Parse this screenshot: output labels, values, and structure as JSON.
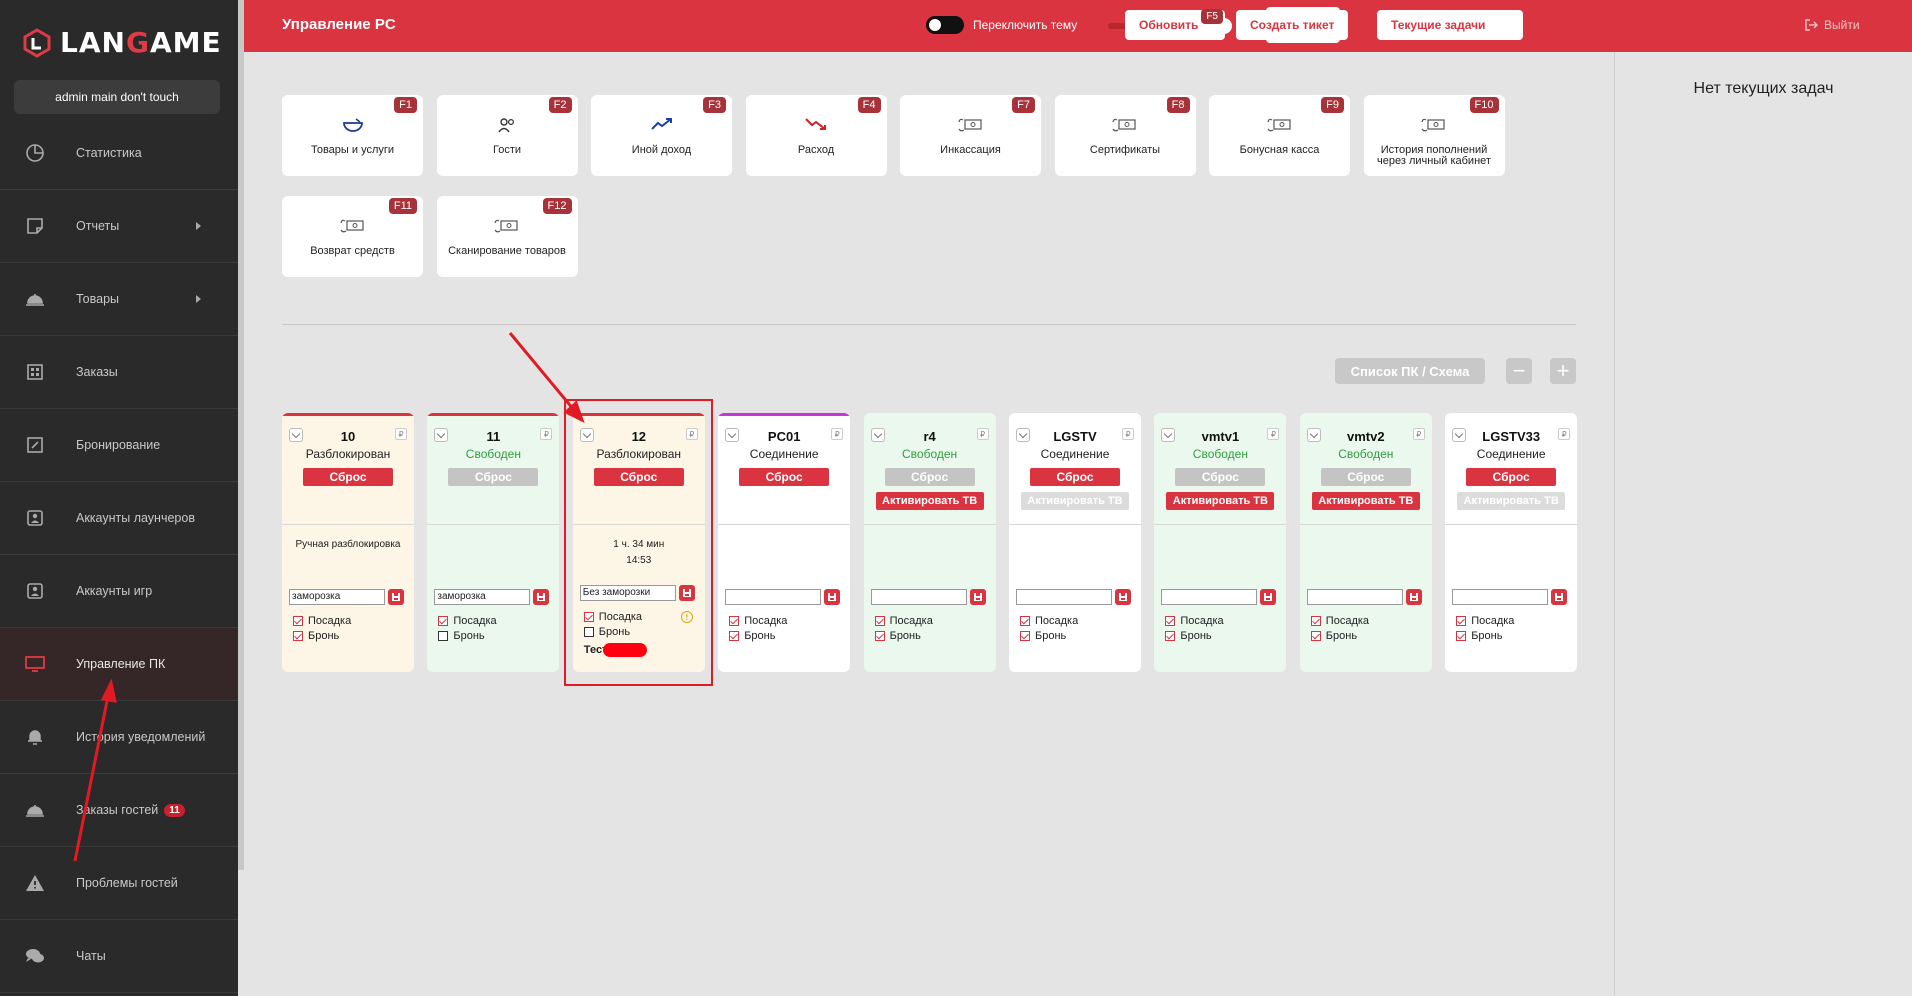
{
  "sidebar": {
    "logo_text": "LANGAME",
    "user": "admin main don't touch",
    "items": [
      {
        "label": "Статистика",
        "icon": "pie-chart-icon",
        "arrow": false
      },
      {
        "label": "Отчеты",
        "icon": "report-icon",
        "arrow": true
      },
      {
        "label": "Товары",
        "icon": "cloche-icon",
        "arrow": true
      },
      {
        "label": "Заказы",
        "icon": "grid-icon",
        "arrow": false
      },
      {
        "label": "Бронирование",
        "icon": "edit-square-icon",
        "arrow": false
      },
      {
        "label": "Аккаунты лаунчеров",
        "icon": "account-card-icon",
        "arrow": false
      },
      {
        "label": "Аккаунты игр",
        "icon": "account-card-icon",
        "arrow": false
      },
      {
        "label": "Управление ПК",
        "icon": "monitor-icon",
        "arrow": false,
        "active": true
      },
      {
        "label": "История уведомлений",
        "icon": "bell-icon",
        "arrow": false
      },
      {
        "label": "Заказы гостей",
        "icon": "cloche-icon",
        "arrow": false,
        "badge": "11"
      },
      {
        "label": "Проблемы гостей",
        "icon": "warning-icon",
        "arrow": false
      },
      {
        "label": "Чаты",
        "icon": "chat-icon",
        "arrow": false
      }
    ]
  },
  "header": {
    "title": "Управление PC",
    "theme_toggle_label": "Переключить тему",
    "language": "ru",
    "refresh_label": "Обновить",
    "refresh_key": "F5",
    "ticket_label": "Создать тикет",
    "tasks_label": "Текущие задачи",
    "logout_label": "Выйти"
  },
  "right_panel": {
    "message": "Нет текущих задач"
  },
  "tiles": [
    {
      "label": "Товары и услуги",
      "key": "F1",
      "icon": "bowl-icon"
    },
    {
      "label": "Гости",
      "key": "F2",
      "icon": "users-icon"
    },
    {
      "label": "Иной доход",
      "key": "F3",
      "icon": "trend-up-icon"
    },
    {
      "label": "Расход",
      "key": "F4",
      "icon": "trend-down-icon"
    },
    {
      "label": "Инкассация",
      "key": "F7",
      "icon": "money-cycle-icon"
    },
    {
      "label": "Сертификаты",
      "key": "F8",
      "icon": "money-cycle-icon"
    },
    {
      "label": "Бонусная касса",
      "key": "F9",
      "icon": "money-cycle-icon"
    },
    {
      "label": "История пополнений через личный кабинет",
      "key": "F10",
      "icon": "money-cycle-icon"
    },
    {
      "label": "Возврат средств",
      "key": "F11",
      "icon": "money-cycle-icon"
    },
    {
      "label": "Сканирование товаров",
      "key": "F12",
      "icon": "money-cycle-icon"
    }
  ],
  "controls": {
    "list_scheme_label": "Список ПК / Схема",
    "zoom_out": "−",
    "zoom_in": "+"
  },
  "colors": {
    "accent": "#d93440",
    "sidebar": "#2a2a2a",
    "free_text": "#2e9e3e",
    "warn_bg": "#fdf6e6",
    "free_bg": "#eaf8ee"
  },
  "pcs": [
    {
      "name": "10",
      "status": "Разблокирован",
      "status_color": "#222",
      "bg": "#fdf6e6",
      "bar": "#d93440",
      "reset_label": "Сброс",
      "reset_active": true,
      "activate": null,
      "note": [
        "Ручная разблокировка"
      ],
      "input_value": "заморозка",
      "posadka_label": "Посадка",
      "posadka": true,
      "bron_label": "Бронь",
      "bron": true
    },
    {
      "name": "11",
      "status": "Свободен",
      "status_color": "#2e9e3e",
      "bg": "#eaf8ee",
      "bar": "#d93440",
      "reset_label": "Сброс",
      "reset_active": false,
      "activate": null,
      "note": [],
      "input_value": "заморозка",
      "posadka_label": "Посадка",
      "posadka": true,
      "bron_label": "Бронь",
      "bron": false
    },
    {
      "name": "12",
      "status": "Разблокирован",
      "status_color": "#222",
      "bg": "#fdf6e6",
      "bar": "#d93440",
      "reset_label": "Сброс",
      "reset_active": true,
      "activate": null,
      "note": [
        "1 ч. 34 мин",
        "14:53"
      ],
      "input_value": "Без заморозки",
      "posadka_label": "Посадка",
      "posadka": true,
      "bron_label": "Бронь",
      "bron": false,
      "warning": "!",
      "test_label": "Тест"
    },
    {
      "name": "PC01",
      "status": "Соединение",
      "status_color": "#222",
      "bg": "#ffffff",
      "bar": "#c832d8",
      "reset_label": "Сброс",
      "reset_active": true,
      "activate": null,
      "note": [],
      "input_value": "",
      "posadka_label": "Посадка",
      "posadka": true,
      "bron_label": "Бронь",
      "bron": true
    },
    {
      "name": "r4",
      "status": "Свободен",
      "status_color": "#2e9e3e",
      "bg": "#eaf8ee",
      "bar": null,
      "reset_label": "Сброс",
      "reset_active": false,
      "activate": {
        "label": "Активировать ТВ",
        "active": true
      },
      "note": [],
      "input_value": "",
      "posadka_label": "Посадка",
      "posadka": true,
      "bron_label": "Бронь",
      "bron": true
    },
    {
      "name": "LGSTV",
      "status": "Соединение",
      "status_color": "#222",
      "bg": "#ffffff",
      "bar": null,
      "reset_label": "Сброс",
      "reset_active": true,
      "activate": {
        "label": "Активировать ТВ",
        "active": false
      },
      "note": [],
      "input_value": "",
      "posadka_label": "Посадка",
      "posadka": true,
      "bron_label": "Бронь",
      "bron": true
    },
    {
      "name": "vmtv1",
      "status": "Свободен",
      "status_color": "#2e9e3e",
      "bg": "#eaf8ee",
      "bar": null,
      "reset_label": "Сброс",
      "reset_active": false,
      "activate": {
        "label": "Активировать ТВ",
        "active": true
      },
      "note": [],
      "input_value": "",
      "posadka_label": "Посадка",
      "posadka": true,
      "bron_label": "Бронь",
      "bron": true
    },
    {
      "name": "vmtv2",
      "status": "Свободен",
      "status_color": "#2e9e3e",
      "bg": "#eaf8ee",
      "bar": null,
      "reset_label": "Сброс",
      "reset_active": false,
      "activate": {
        "label": "Активировать ТВ",
        "active": true
      },
      "note": [],
      "input_value": "",
      "posadka_label": "Посадка",
      "posadka": true,
      "bron_label": "Бронь",
      "bron": true
    },
    {
      "name": "LGSTV33",
      "status": "Соединение",
      "status_color": "#222",
      "bg": "#ffffff",
      "bar": null,
      "reset_label": "Сброс",
      "reset_active": true,
      "activate": {
        "label": "Активировать ТВ",
        "active": false
      },
      "note": [],
      "input_value": "",
      "posadka_label": "Посадка",
      "posadka": true,
      "bron_label": "Бронь",
      "bron": true
    }
  ]
}
